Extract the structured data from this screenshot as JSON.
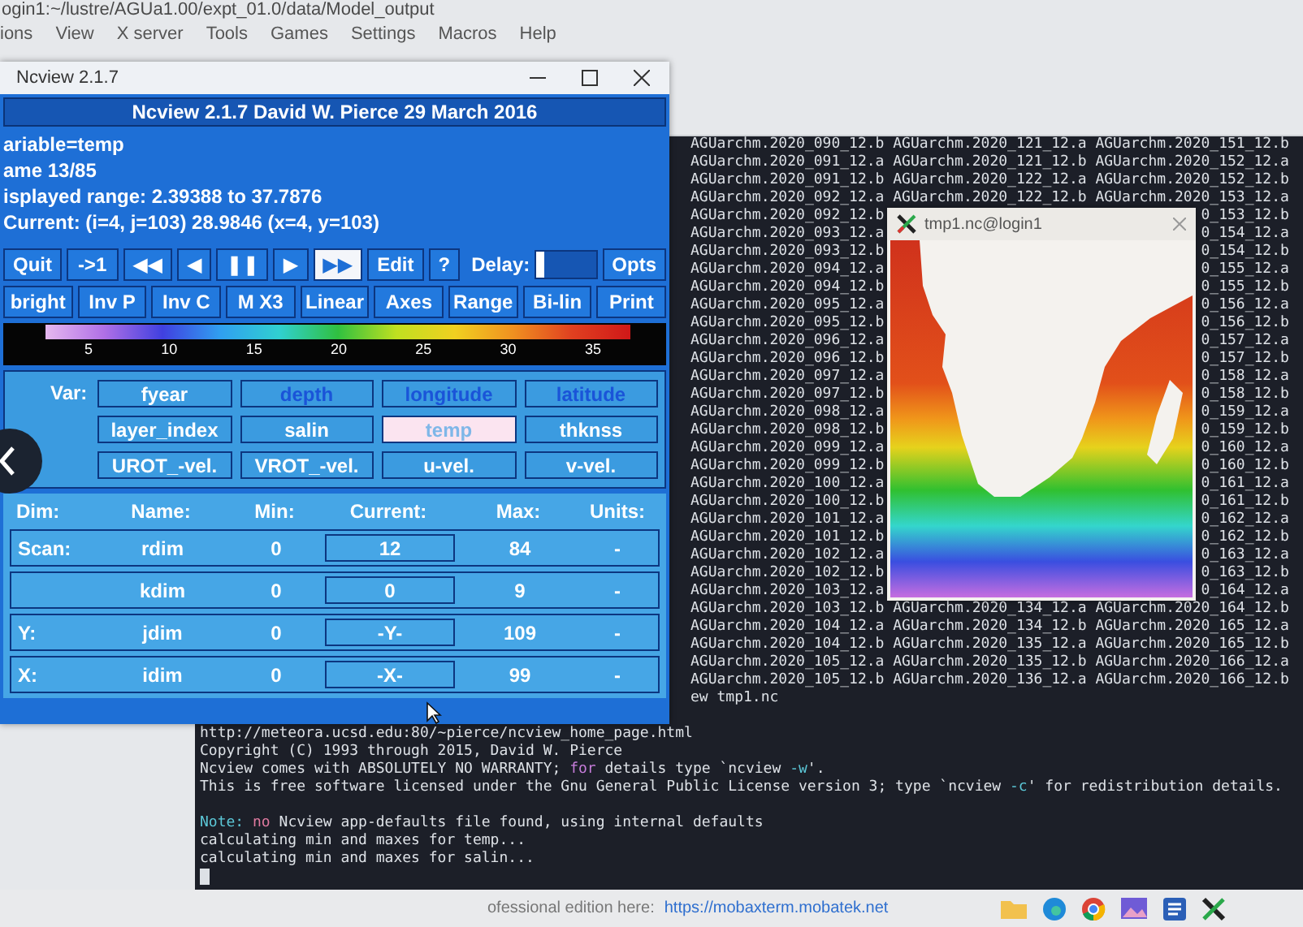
{
  "app": {
    "title": "ogin1:~/lustre/AGUa1.00/expt_01.0/data/Model_output",
    "menu": [
      "ions",
      "View",
      "X server",
      "Tools",
      "Games",
      "Settings",
      "Macros",
      "Help"
    ]
  },
  "ncview": {
    "title": "Ncview 2.1.7",
    "banner": "Ncview 2.1.7 David W. Pierce  29 March 2016",
    "info": [
      "ariable=temp",
      "ame 13/85",
      "isplayed range: 2.39388 to 37.7876",
      "Current: (i=4, j=103) 28.9846 (x=4, y=103)"
    ],
    "toolbar": [
      {
        "kind": "button",
        "label": "Quit",
        "selected": false
      },
      {
        "kind": "button",
        "label": "->1",
        "selected": false
      },
      {
        "kind": "button",
        "label": "◀◀",
        "selected": false
      },
      {
        "kind": "button",
        "label": "◀",
        "selected": false
      },
      {
        "kind": "button",
        "label": "❚❚",
        "selected": false
      },
      {
        "kind": "button",
        "label": "▶",
        "selected": false
      },
      {
        "kind": "button",
        "label": "▶▶",
        "selected": true
      },
      {
        "kind": "button",
        "label": "Edit",
        "selected": false
      },
      {
        "kind": "button",
        "label": "?",
        "selected": false
      },
      {
        "kind": "label",
        "label": "Delay:"
      },
      {
        "kind": "slider",
        "level": 0.12
      },
      {
        "kind": "button",
        "label": "Opts",
        "selected": false
      }
    ],
    "options": [
      "bright",
      "Inv P",
      "Inv C",
      "M X3",
      "Linear",
      "Axes",
      "Range",
      "Bi-lin",
      "Print"
    ],
    "colorbar": {
      "ticks": [
        "5",
        "10",
        "15",
        "20",
        "25",
        "30",
        "35"
      ]
    },
    "variables": {
      "label": "Var:",
      "items": [
        {
          "name": "fyear",
          "kind": "variable",
          "selected": false
        },
        {
          "name": "depth",
          "kind": "coordinate",
          "selected": false
        },
        {
          "name": "longitude",
          "kind": "coordinate",
          "selected": false
        },
        {
          "name": "latitude",
          "kind": "coordinate",
          "selected": false
        },
        {
          "name": "layer_index",
          "kind": "variable",
          "selected": false
        },
        {
          "name": "salin",
          "kind": "variable",
          "selected": false
        },
        {
          "name": "temp",
          "kind": "variable",
          "selected": true
        },
        {
          "name": "thknss",
          "kind": "variable",
          "selected": false
        },
        {
          "name": "UROT_-vel.",
          "kind": "variable",
          "selected": false
        },
        {
          "name": "VROT_-vel.",
          "kind": "variable",
          "selected": false
        },
        {
          "name": "u-vel.",
          "kind": "variable",
          "selected": false
        },
        {
          "name": "v-vel.",
          "kind": "variable",
          "selected": false
        }
      ]
    },
    "dimensions": {
      "headers": [
        "Dim:",
        "Name:",
        "Min:",
        "Current:",
        "Max:",
        "Units:"
      ],
      "rows": [
        {
          "dim": "Scan:",
          "name": "rdim",
          "min": "0",
          "current": "12",
          "max": "84",
          "units": "-"
        },
        {
          "name": "kdim",
          "min": "0",
          "current": "0",
          "max": "9",
          "units": "-"
        },
        {
          "dim": "Y:",
          "name": "jdim",
          "min": "0",
          "current": "-Y-",
          "max": "109",
          "units": "-"
        },
        {
          "dim": "X:",
          "name": "idim",
          "min": "0",
          "current": "-X-",
          "max": "99",
          "units": "-"
        }
      ]
    }
  },
  "plot_window": {
    "title": "tmp1.nc@login1"
  },
  "terminal": {
    "listing": [
      {
        "column_1": "AGUarchm.2020_090_12.b",
        "column_2": "AGUarchm.2020_121_12.a",
        "column_3": "AGUarchm.2020_151_12.b"
      },
      {
        "column_1": "AGUarchm.2020_091_12.a",
        "column_2": "AGUarchm.2020_121_12.b",
        "column_3": "AGUarchm.2020_152_12.a"
      },
      {
        "column_1": "AGUarchm.2020_091_12.b",
        "column_2": "AGUarchm.2020_122_12.a",
        "column_3": "AGUarchm.2020_152_12.b"
      },
      {
        "column_1": "AGUarchm.2020_092_12.a",
        "column_2": "AGUarchm.2020_122_12.b",
        "column_3": "AGUarchm.2020_153_12.a"
      },
      {
        "column_1": "AGUarchm.2020_092_12.b",
        "column_3": "0_153_12.b"
      },
      {
        "column_1": "AGUarchm.2020_093_12.a",
        "column_3": "0_154_12.a"
      },
      {
        "column_1": "AGUarchm.2020_093_12.b",
        "column_3": "0_154_12.b"
      },
      {
        "column_1": "AGUarchm.2020_094_12.a",
        "column_3": "0_155_12.a"
      },
      {
        "column_1": "AGUarchm.2020_094_12.b",
        "column_3": "0_155_12.b"
      },
      {
        "column_1": "AGUarchm.2020_095_12.a",
        "column_3": "0_156_12.a"
      },
      {
        "column_1": "AGUarchm.2020_095_12.b",
        "column_3": "0_156_12.b"
      },
      {
        "column_1": "AGUarchm.2020_096_12.a",
        "column_3": "0_157_12.a"
      },
      {
        "column_1": "AGUarchm.2020_096_12.b",
        "column_3": "0_157_12.b"
      },
      {
        "column_1": "AGUarchm.2020_097_12.a",
        "column_3": "0_158_12.a"
      },
      {
        "column_1": "AGUarchm.2020_097_12.b",
        "column_3": "0_158_12.b"
      },
      {
        "column_1": "AGUarchm.2020_098_12.a",
        "column_3": "0_159_12.a"
      },
      {
        "column_1": "AGUarchm.2020_098_12.b",
        "column_3": "0_159_12.b"
      },
      {
        "column_1": "AGUarchm.2020_099_12.a",
        "column_3": "0_160_12.a"
      },
      {
        "column_1": "AGUarchm.2020_099_12.b",
        "column_3": "0_160_12.b"
      },
      {
        "column_1": "AGUarchm.2020_100_12.a",
        "column_3": "0_161_12.a"
      },
      {
        "column_1": "AGUarchm.2020_100_12.b",
        "column_3": "0_161_12.b"
      },
      {
        "column_1": "AGUarchm.2020_101_12.a",
        "column_3": "0_162_12.a"
      },
      {
        "column_1": "AGUarchm.2020_101_12.b",
        "column_3": "0_162_12.b"
      },
      {
        "column_1": "AGUarchm.2020_102_12.a",
        "column_3": "0_163_12.a"
      },
      {
        "column_1": "AGUarchm.2020_102_12.b",
        "column_3": "0_163_12.b"
      },
      {
        "column_1": "AGUarchm.2020_103_12.a",
        "column_3": "0_164_12.a"
      },
      {
        "column_1": "AGUarchm.2020_103_12.b",
        "column_2": "AGUarchm.2020_134_12.a",
        "column_3": "AGUarchm.2020_164_12.b"
      },
      {
        "column_1": "AGUarchm.2020_104_12.a",
        "column_2": "AGUarchm.2020_134_12.b",
        "column_3": "AGUarchm.2020_165_12.a"
      },
      {
        "column_1": "AGUarchm.2020_104_12.b",
        "column_2": "AGUarchm.2020_135_12.a",
        "column_3": "AGUarchm.2020_165_12.b"
      },
      {
        "column_1": "AGUarchm.2020_105_12.a",
        "column_2": "AGUarchm.2020_135_12.b",
        "column_3": "AGUarchm.2020_166_12.a"
      },
      {
        "column_1": "AGUarchm.2020_105_12.b",
        "column_2": "AGUarchm.2020_136_12.a",
        "column_3": "AGUarchm.2020_166_12.b"
      }
    ],
    "lines": [
      {
        "kind": "listing",
        "segments": [
          {
            "kind": "plain",
            "text": "ew tmp1.nc"
          }
        ]
      },
      {
        "kind": "blank"
      },
      {
        "kind": "text",
        "segments": [
          {
            "kind": "plain",
            "text": "http://meteora.ucsd.edu:80/~pierce/ncview_home_page.html"
          }
        ]
      },
      {
        "kind": "text",
        "segments": [
          {
            "kind": "plain",
            "text": "Copyright (C) 1993 through 2015, David W. Pierce"
          }
        ]
      },
      {
        "kind": "text",
        "segments": [
          {
            "kind": "plain",
            "text": "Ncview comes with ABSOLUTELY NO WARRANTY; "
          },
          {
            "kind": "keyword",
            "text": "for"
          },
          {
            "kind": "plain",
            "text": " details type `ncview "
          },
          {
            "kind": "flag",
            "text": "-w"
          },
          {
            "kind": "plain",
            "text": "'."
          }
        ]
      },
      {
        "kind": "text",
        "segments": [
          {
            "kind": "plain",
            "text": "This is free software licensed under the Gnu General Public License version 3; type `ncview "
          },
          {
            "kind": "flag",
            "text": "-c"
          },
          {
            "kind": "plain",
            "text": "' for redistribution details."
          }
        ]
      },
      {
        "kind": "blank"
      },
      {
        "kind": "text",
        "segments": [
          {
            "kind": "note",
            "text": "Note: "
          },
          {
            "kind": "warn",
            "text": "no"
          },
          {
            "kind": "plain",
            "text": " Ncview app-defaults file found, using internal defaults"
          }
        ]
      },
      {
        "kind": "text",
        "segments": [
          {
            "kind": "plain",
            "text": "calculating min and maxes for temp..."
          }
        ]
      },
      {
        "kind": "text",
        "segments": [
          {
            "kind": "plain",
            "text": "calculating min and maxes for salin..."
          }
        ]
      },
      {
        "kind": "cursor"
      }
    ]
  },
  "footer": {
    "text": "ofessional edition here:",
    "link": "https://mobaxterm.mobatek.net"
  }
}
